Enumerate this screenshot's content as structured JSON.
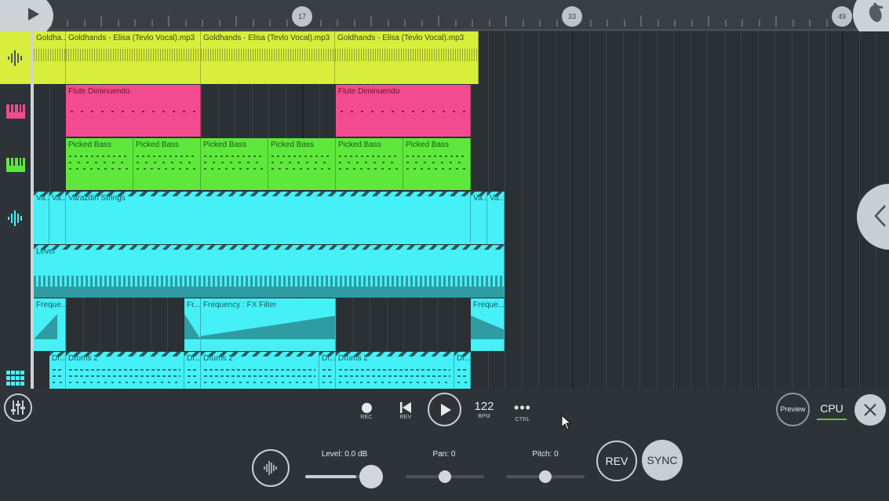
{
  "ruler": {
    "markers": [
      "17",
      "33",
      "49"
    ]
  },
  "tracks": [
    {
      "icon": "audio-waveform-icon",
      "clips": [
        {
          "label": "Goldha..."
        },
        {
          "label": "Goldhands - Elisa (Tevlo Vocal).mp3"
        },
        {
          "label": "Goldhands - Elisa (Tevlo Vocal).mp3"
        },
        {
          "label": "Goldhands - Elisa (Tevlo Vocal).mp3"
        }
      ]
    },
    {
      "icon": "piano-keys-icon",
      "clips": [
        {
          "label": "Flute Diminuendo"
        },
        {
          "label": "Flute Diminuendo"
        }
      ]
    },
    {
      "icon": "piano-keys-icon",
      "clips": [
        {
          "label": "Picked Bass"
        },
        {
          "label": "Picked Bass"
        },
        {
          "label": "Picked Bass"
        },
        {
          "label": "Picked Bass"
        },
        {
          "label": "Picked Bass"
        },
        {
          "label": "Picked Bass"
        }
      ]
    },
    {
      "icon": "audio-waveform-icon",
      "clips": [
        {
          "label": "Va..."
        },
        {
          "label": "Va..."
        },
        {
          "label": "Varazdin Strings"
        },
        {
          "label": "Va..."
        },
        {
          "label": "Va..."
        }
      ]
    },
    {
      "icon": "",
      "clips": [
        {
          "label": "Level"
        }
      ]
    },
    {
      "icon": "",
      "clips": [
        {
          "label": "Freque..."
        },
        {
          "label": "Fr..."
        },
        {
          "label": "Frequency : FX Filter"
        },
        {
          "label": "Freque..."
        }
      ]
    },
    {
      "icon": "drum-pads-icon",
      "clips": [
        {
          "label": "Dr..."
        },
        {
          "label": "Drums 2"
        },
        {
          "label": "Dr..."
        },
        {
          "label": "Drums 2"
        },
        {
          "label": "Dr..."
        },
        {
          "label": "Drums 2"
        },
        {
          "label": "Dr..."
        }
      ]
    }
  ],
  "transport": {
    "rec": "REC",
    "rev": "REV",
    "bpm_value": "122",
    "bpm": "BPM",
    "ctrl": "CTRL",
    "preview": "Preview",
    "cpu": "CPU"
  },
  "channel": {
    "level_label": "Level: 0.0 dB",
    "level_value": 0.76,
    "pan_label": "Pan: 0",
    "pan_value": 0.5,
    "pitch_label": "Pitch: 0",
    "pitch_value": 0.5,
    "rev_label": "REV",
    "sync_label": "SYNC"
  },
  "colors": {
    "audio": "#d7ef3c",
    "flute": "#f24b8f",
    "bass": "#5ee83c",
    "cyan": "#45f0f6",
    "cpu_meter": "#4fcf3a"
  }
}
